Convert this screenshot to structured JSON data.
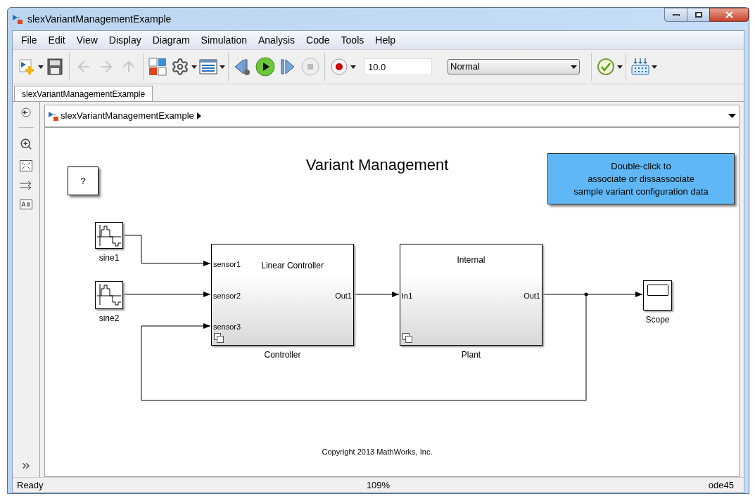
{
  "window": {
    "title": "slexVariantManagementExample"
  },
  "menu": [
    "File",
    "Edit",
    "View",
    "Display",
    "Diagram",
    "Simulation",
    "Analysis",
    "Code",
    "Tools",
    "Help"
  ],
  "toolbar": {
    "stop_time": "10.0",
    "sim_mode": "Normal"
  },
  "tabs": [
    {
      "label": "slexVariantManagementExample",
      "selected": true
    }
  ],
  "breadcrumb": [
    "slexVariantManagementExample"
  ],
  "diagram": {
    "title": "Variant Management",
    "help_block": "?",
    "annotation": [
      "Double-click to",
      "associate or dissassociate",
      "sample variant configuration data"
    ],
    "blocks": [
      {
        "kind": "source",
        "name": "sine1"
      },
      {
        "kind": "source",
        "name": "sine2"
      },
      {
        "kind": "subsystem",
        "name": "Controller",
        "variant": "Linear Controller",
        "inputs": [
          "sensor1",
          "sensor2",
          "sensor3"
        ],
        "outputs": [
          "Out1"
        ]
      },
      {
        "kind": "subsystem",
        "name": "Plant",
        "variant": "Internal",
        "inputs": [
          "In1"
        ],
        "outputs": [
          "Out1"
        ]
      },
      {
        "kind": "sink",
        "name": "Scope"
      }
    ],
    "copyright": "Copyright 2013 MathWorks, Inc."
  },
  "status_bar": {
    "state": "Ready",
    "zoom": "109%",
    "solver": "ode45"
  }
}
